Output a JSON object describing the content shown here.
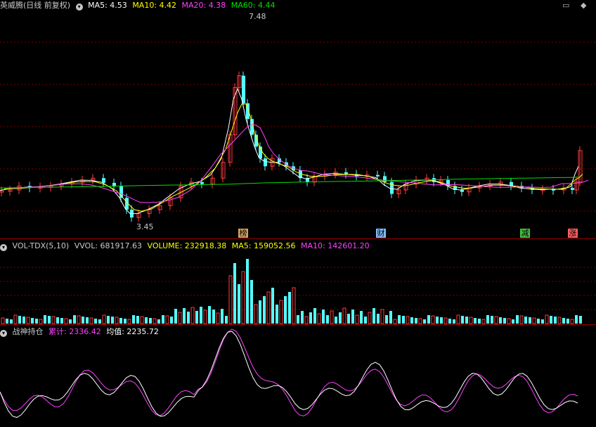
{
  "main": {
    "title": "英威腾(日线 前复权)",
    "ma5": "MA5: 4.53",
    "ma10": "MA10: 4.42",
    "ma20": "MA20: 4.38",
    "ma60": "MA60: 4.44",
    "high_label": "7.48",
    "low_label": "3.45",
    "markers": [
      {
        "text": "榜",
        "color": "#d4a060"
      },
      {
        "text": "财",
        "color": "#7fc0ff"
      },
      {
        "text": "减",
        "color": "#40c040"
      },
      {
        "text": "涨",
        "color": "#ff6060"
      }
    ]
  },
  "volume": {
    "title": "VOL-TDX(5,10)",
    "vvol": "VVOL: 681917.63",
    "volume": "VOLUME: 232918.38",
    "ma5": "MA5: 159052.56",
    "ma10": "MA10: 142601.20"
  },
  "indicator": {
    "title": "战神持仓",
    "cum": "累计: 2336.42",
    "avg": "均值: 2235.72"
  },
  "colors": {
    "up": "#ff3c3c",
    "down": "#54ffff",
    "ma5": "#ffffff",
    "ma10": "#ffff00",
    "ma20": "#ff40ff",
    "ma60": "#00e000"
  },
  "icons": {
    "collapse": "circle-down-icon",
    "window": "window-restore-icon",
    "nav": "diamond-arrows-icon"
  }
}
